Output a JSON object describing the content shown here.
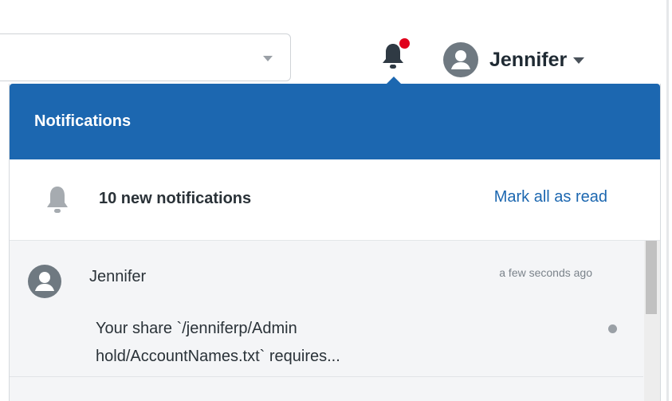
{
  "header": {
    "user_name": "Jennifer"
  },
  "notifications_panel": {
    "title": "Notifications",
    "summary": {
      "count_label": "10 new notifications",
      "mark_all_label": "Mark all as read"
    },
    "items": [
      {
        "author": "Jennifer",
        "time": "a few seconds ago",
        "message": "Your share `/jenniferp/Admin hold/AccountNames.txt` requires..."
      }
    ]
  },
  "colors": {
    "accent": "#1c67b0",
    "badge": "#e0001b"
  },
  "icons": {
    "bell": "bell-icon",
    "avatar": "user-avatar-icon",
    "caret": "caret-down-icon"
  }
}
